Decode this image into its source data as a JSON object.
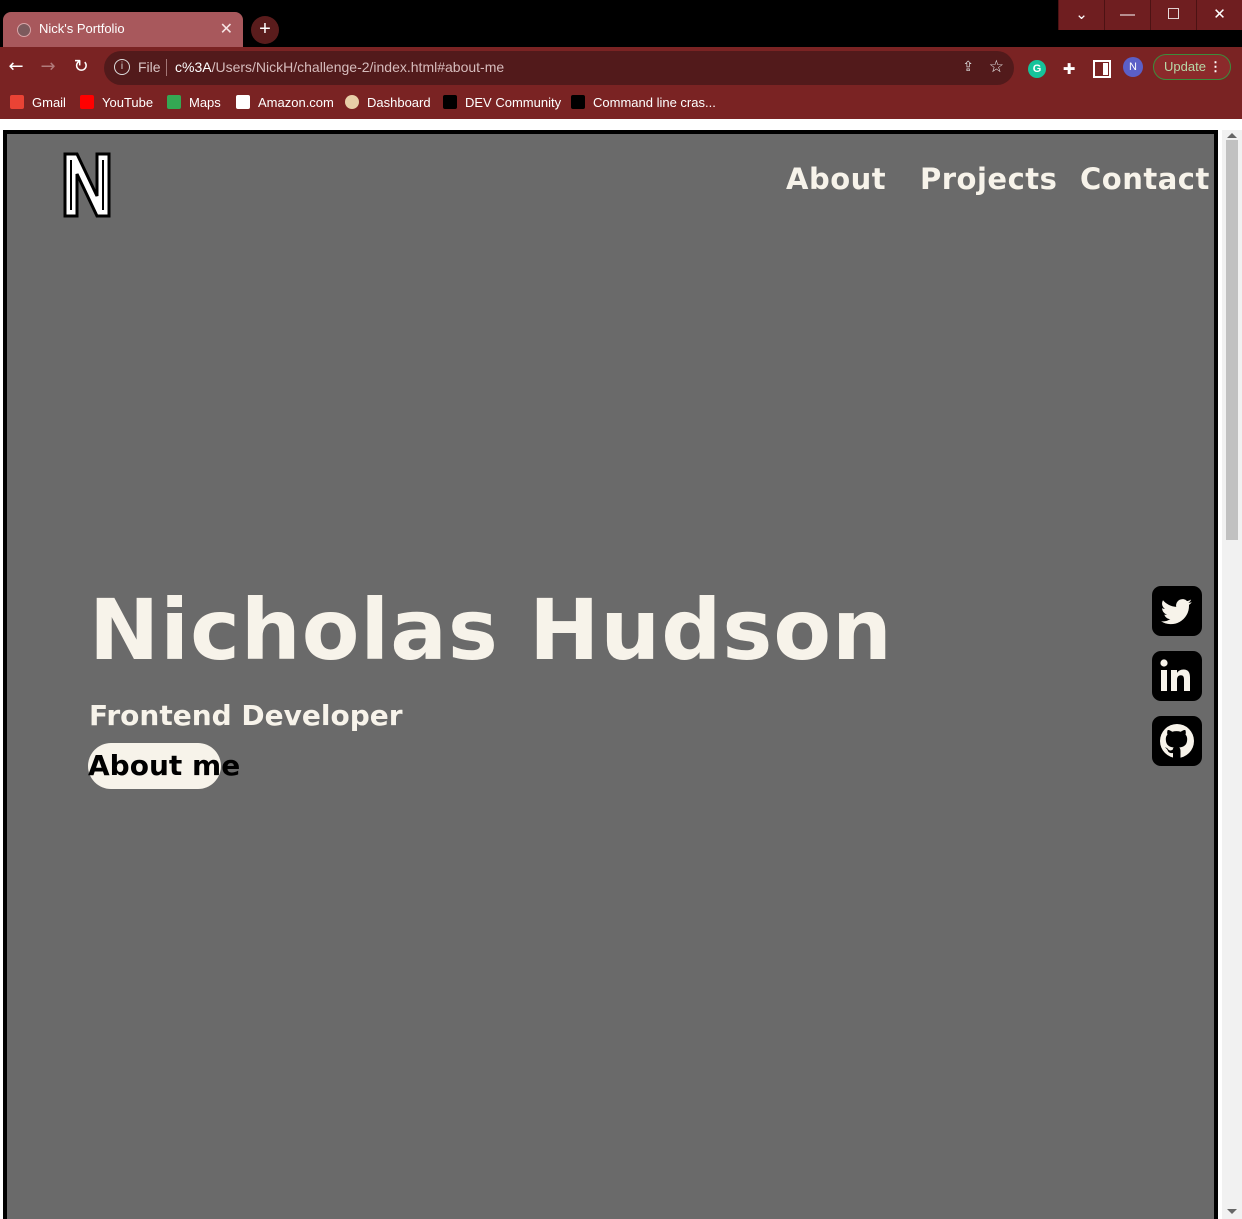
{
  "browser": {
    "tab": {
      "title": "Nick's Portfolio",
      "close": "✕"
    },
    "new_tab": "+",
    "window_controls": {
      "dropdown": "⌄",
      "minimize": "—",
      "maximize": "☐",
      "close": "✕"
    },
    "omnibox": {
      "scheme": "File",
      "host": "c%3A",
      "path": "/Users/NickH/challenge-2/index.html#about-me"
    },
    "profile_initial": "N",
    "grammarly": "G",
    "update_label": "Update",
    "update_dots": "⋮",
    "bookmarks": [
      {
        "label": "Gmail",
        "color": "#ea4335"
      },
      {
        "label": "YouTube",
        "color": "#ff0000"
      },
      {
        "label": "Maps",
        "color": "#34a853"
      },
      {
        "label": "Amazon.com",
        "color": "#ffffff"
      },
      {
        "label": "Dashboard",
        "color": "#e8cfa8"
      },
      {
        "label": "DEV Community",
        "color": "#000000"
      },
      {
        "label": "Command line cras...",
        "color": "#000000"
      }
    ]
  },
  "site": {
    "logo_letter": "N",
    "nav": {
      "about": "About",
      "projects": "Projects",
      "contact": "Contact"
    },
    "hero": {
      "name": "Nicholas Hudson",
      "role": "Frontend Developer",
      "button": "About me"
    },
    "social": [
      "twitter-icon",
      "linkedin-icon",
      "github-icon"
    ],
    "colors": {
      "page_bg": "#6a6a6a",
      "text": "#f7f3ea",
      "chrome": "#7a2323"
    }
  }
}
